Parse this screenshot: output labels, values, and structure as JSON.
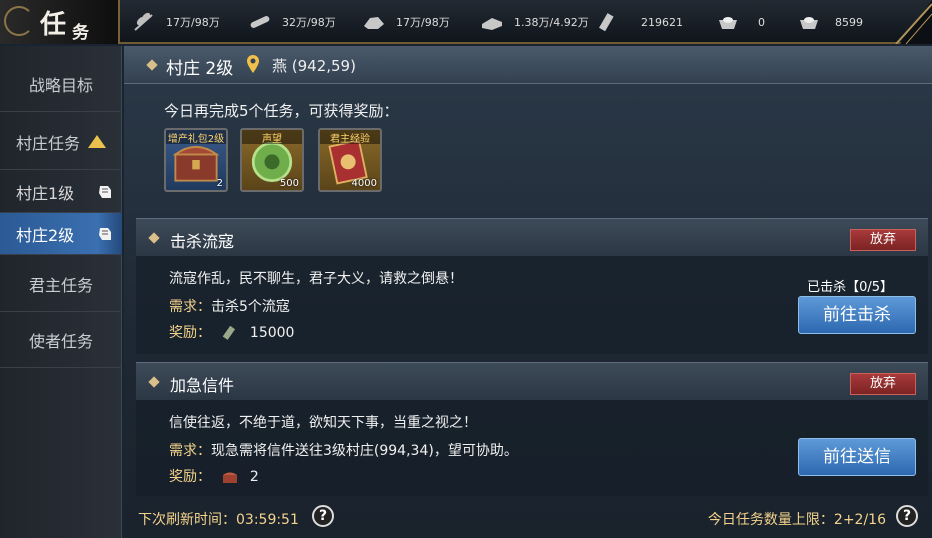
{
  "header": {
    "title_char1": "任",
    "title_char2": "务",
    "resources": [
      {
        "icon": "wheat-icon",
        "value": "17万/98万"
      },
      {
        "icon": "wood-icon",
        "value": "32万/98万"
      },
      {
        "icon": "stone-icon",
        "value": "17万/98万"
      },
      {
        "icon": "iron-icon",
        "value": "1.38万/4.92万"
      },
      {
        "icon": "coin-bundle-icon",
        "value": "219621"
      },
      {
        "icon": "gold-ingot-icon",
        "value": "0"
      },
      {
        "icon": "silver-ingot-icon",
        "value": "8599"
      }
    ]
  },
  "sidebar": {
    "items": [
      {
        "label": "战略目标"
      },
      {
        "label": "村庄任务"
      },
      {
        "label": "村庄1级"
      },
      {
        "label": "村庄2级"
      },
      {
        "label": "君主任务"
      },
      {
        "label": "使者任务"
      }
    ]
  },
  "village": {
    "title": "村庄 2级",
    "location": "燕 (942,59)",
    "reward_text": "今日再完成5个任务，可获得奖励：",
    "rewards": [
      {
        "label": "增产礼包2级",
        "count": "2",
        "icon": "chest-icon"
      },
      {
        "label": "声望",
        "count": "500",
        "icon": "jade-icon"
      },
      {
        "label": "君主经验",
        "count": "4000",
        "icon": "scroll-icon"
      }
    ]
  },
  "tasks": [
    {
      "title": "击杀流寇",
      "abandon": "放弃",
      "desc": "流寇作乱，民不聊生，君子大义，请救之倒悬！",
      "req_label": "需求：",
      "req_value": "击杀5个流寇",
      "reward_label": "奖励：",
      "reward_value": "15000",
      "progress": "已击杀【0/5】",
      "action": "前往击杀"
    },
    {
      "title": "加急信件",
      "abandon": "放弃",
      "desc": "信使往返，不绝于道，欲知天下事，当重之视之！",
      "req_label": "需求：",
      "req_value": "现急需将信件送往3级村庄(994,34)，望可协助。",
      "reward_label": "奖励：",
      "reward_value": "2",
      "action": "前往送信"
    }
  ],
  "footer": {
    "refresh": "下次刷新时间：03:59:51",
    "limit": "今日任务数量上限：2+2/16",
    "help": "?"
  },
  "colors": {
    "accent_gold": "#f3d38c",
    "button_blue": "#3a78c2",
    "abandon_red": "#9a2f2f",
    "active_tab": "#3a6fb0"
  }
}
